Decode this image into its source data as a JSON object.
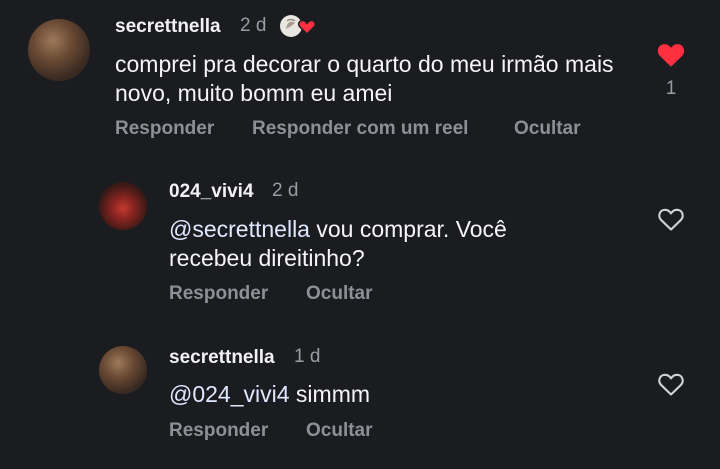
{
  "main_comment": {
    "username": "secrettnella",
    "time": "2 d",
    "text": "comprei pra decorar o quarto do meu irmão mais novo, muito bomm eu amei",
    "liked": true,
    "like_count": "1",
    "actions": {
      "reply": "Responder",
      "reply_reel": "Responder com um reel",
      "hide": "Ocultar"
    },
    "badge_icon": "author-liked-heart-icon"
  },
  "replies": [
    {
      "username": "024_vivi4",
      "time": "2 d",
      "mention": "@secrettnella",
      "text": " vou comprar.  Você recebeu direitinho?",
      "liked": false,
      "actions": {
        "reply": "Responder",
        "hide": "Ocultar"
      }
    },
    {
      "username": "secrettnella",
      "time": "1 d",
      "mention": "@024_vivi4",
      "text": " simmm",
      "liked": false,
      "actions": {
        "reply": "Responder",
        "hide": "Ocultar"
      }
    }
  ],
  "colors": {
    "background": "#1b1c20",
    "like_red": "#ff3040",
    "muted": "#8e9097"
  }
}
